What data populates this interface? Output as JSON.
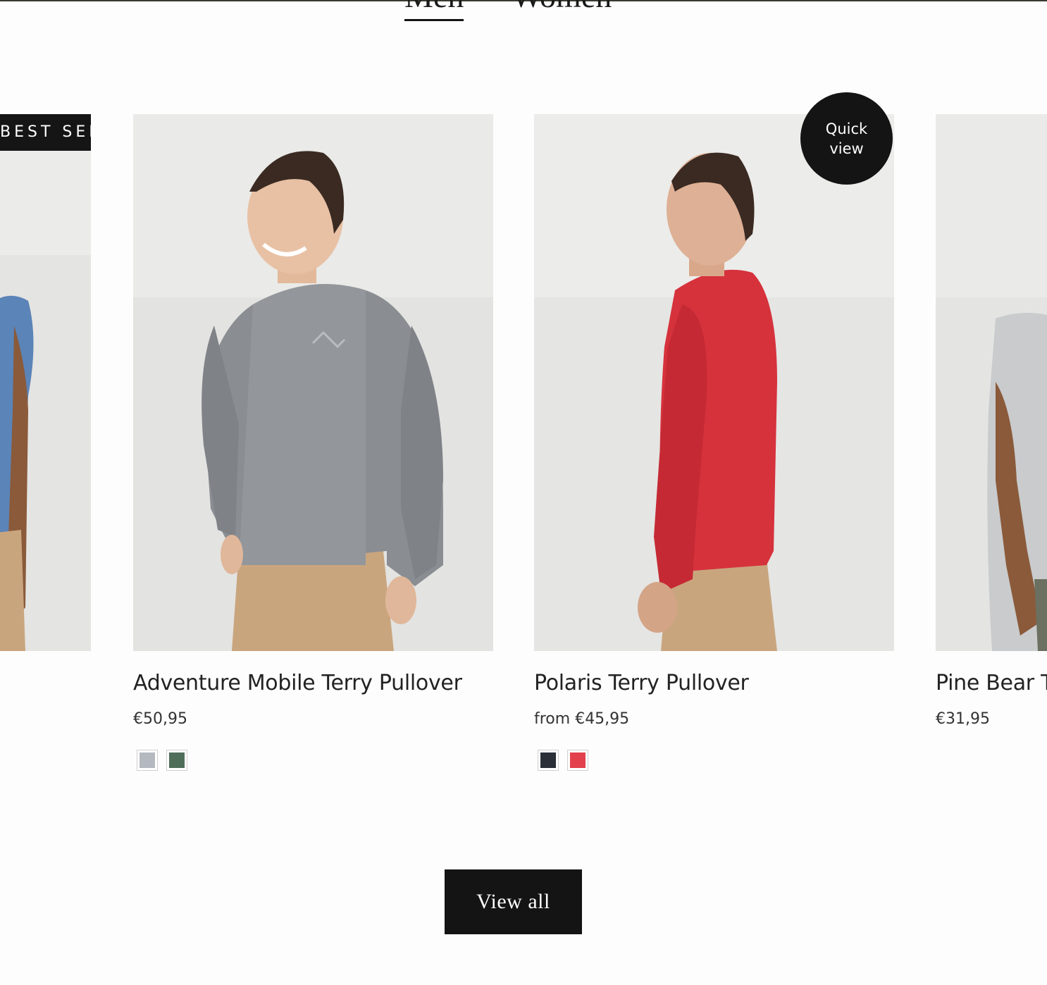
{
  "tabs": [
    {
      "label": "Men",
      "active": true
    },
    {
      "label": "Women",
      "active": false
    }
  ],
  "badge": {
    "label": "BEST SELLING"
  },
  "quick_view": {
    "label": "Quick view"
  },
  "products": [
    {
      "name": "",
      "price": "",
      "shirt_color": "#5b84b8"
    },
    {
      "name": "Adventure Mobile Terry Pullover",
      "price": "€50,95",
      "shirt_color": "#8a8e92",
      "swatches": [
        "#b4b8bf",
        "#4f6e5a"
      ]
    },
    {
      "name": "Polaris Terry Pullover",
      "price": "from €45,95",
      "shirt_color": "#d6323c",
      "swatches": [
        "#2a2f38",
        "#e2404d"
      ]
    },
    {
      "name": "Pine Bear T",
      "price": "€31,95",
      "shirt_color": "#c9cbcd"
    }
  ],
  "view_all": {
    "label": "View all"
  },
  "colors": {
    "dark": "#141414",
    "photo_bg": "#e6e6e4",
    "pants": "#c9a57e"
  }
}
